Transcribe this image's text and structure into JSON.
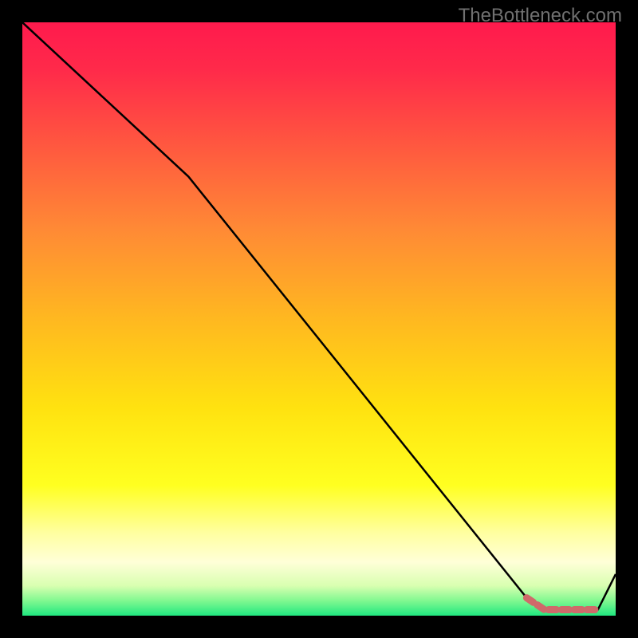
{
  "watermark": "TheBottleneck.com",
  "chart_data": {
    "type": "line",
    "title": "",
    "xlabel": "",
    "ylabel": "",
    "xlim": [
      0,
      100
    ],
    "ylim": [
      0,
      100
    ],
    "series": [
      {
        "name": "curve",
        "color": "#000000",
        "x": [
          0,
          28,
          85,
          88,
          93,
          97,
          100
        ],
        "y": [
          100,
          74,
          3,
          1,
          1,
          1,
          7
        ]
      },
      {
        "name": "highlight",
        "color": "#cf6a6a",
        "x": [
          85,
          88,
          93,
          97
        ],
        "y": [
          3,
          1,
          1,
          1
        ]
      }
    ],
    "gradient_stops": [
      {
        "offset": 0.0,
        "color": "#ff1a4d"
      },
      {
        "offset": 0.08,
        "color": "#ff2a4a"
      },
      {
        "offset": 0.2,
        "color": "#ff5540"
      },
      {
        "offset": 0.35,
        "color": "#ff8a35"
      },
      {
        "offset": 0.5,
        "color": "#ffb820"
      },
      {
        "offset": 0.65,
        "color": "#ffe210"
      },
      {
        "offset": 0.78,
        "color": "#ffff20"
      },
      {
        "offset": 0.86,
        "color": "#ffffa0"
      },
      {
        "offset": 0.91,
        "color": "#ffffd8"
      },
      {
        "offset": 0.95,
        "color": "#d8ffb0"
      },
      {
        "offset": 0.975,
        "color": "#80f890"
      },
      {
        "offset": 1.0,
        "color": "#20e880"
      }
    ]
  }
}
